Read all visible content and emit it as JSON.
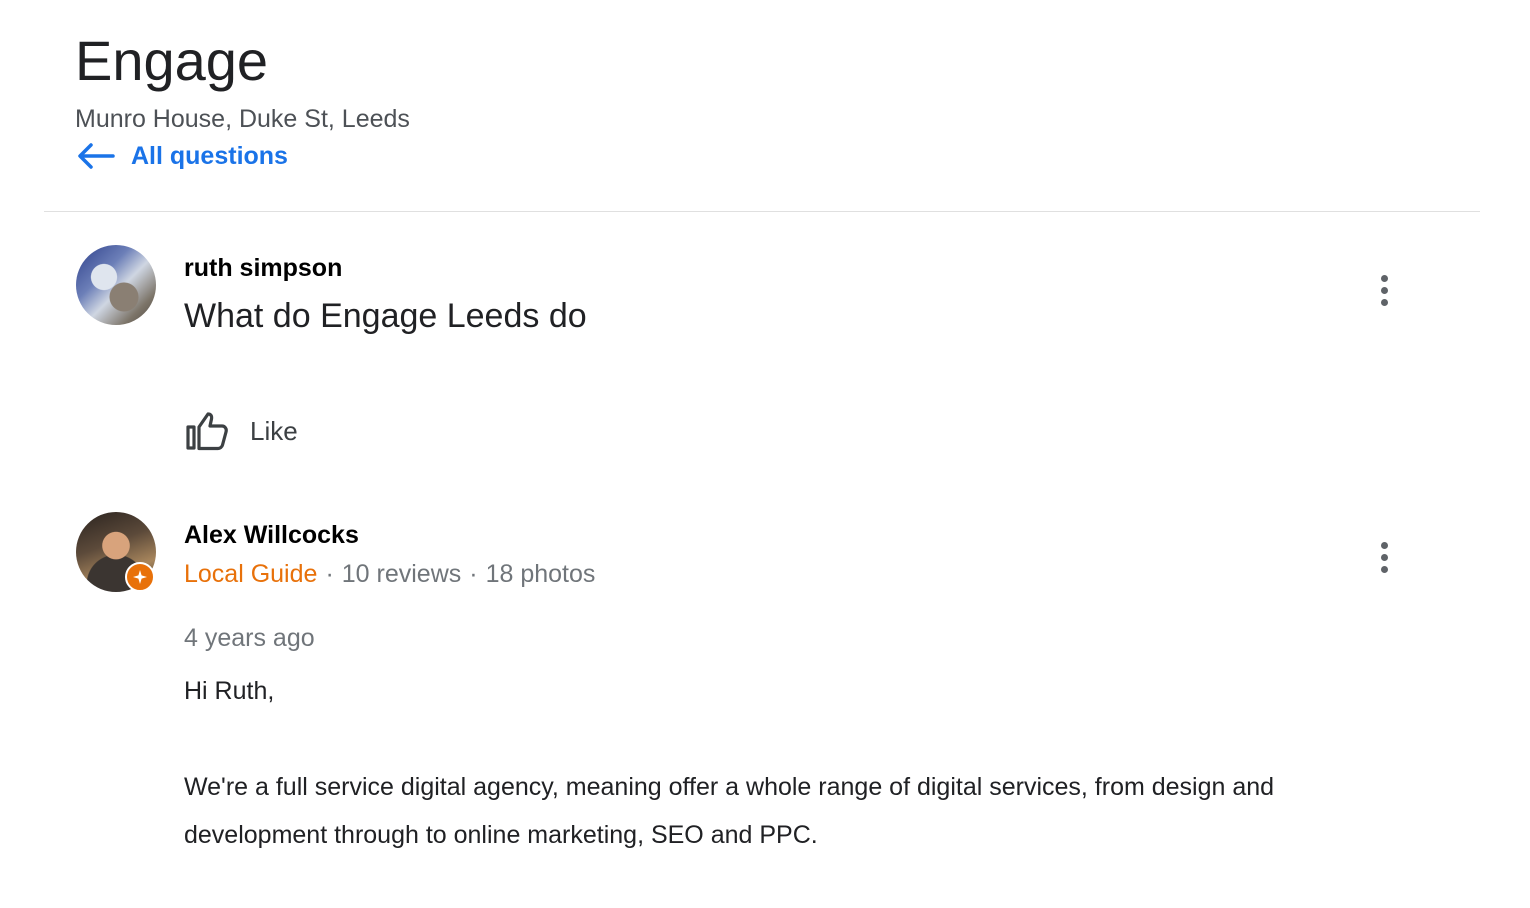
{
  "header": {
    "title": "Engage",
    "address": "Munro House, Duke St, Leeds",
    "back_label": "All questions"
  },
  "question": {
    "author": "ruth simpson",
    "text": "What do Engage Leeds do",
    "like_label": "Like"
  },
  "answer": {
    "author": "Alex Willcocks",
    "guide_label": "Local Guide",
    "separator": "·",
    "reviews": "10 reviews",
    "photos": "18 photos",
    "time_ago": "4 years ago",
    "greeting": "Hi Ruth,",
    "body": "We're a full service digital agency, meaning offer a whole range of digital services, from design and development through to online marketing, SEO and PPC."
  },
  "icons": {
    "back": "arrow-left-icon",
    "like": "thumbs-up-icon",
    "more": "more-vert-icon",
    "badge": "local-guide-badge-icon"
  },
  "colors": {
    "link": "#1a73e8",
    "local_guide": "#e8710a",
    "secondary_text": "#70757a"
  }
}
